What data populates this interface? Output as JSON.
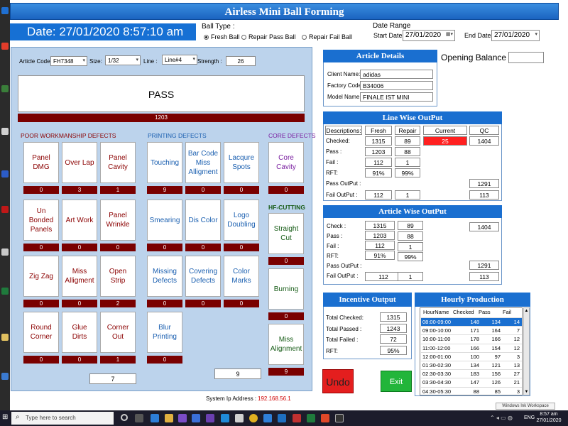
{
  "title": "Airless Mini Ball Forming",
  "datetime": "Date: 27/01/2020 8:57:10 am",
  "ball_type": {
    "label": "Ball Type :",
    "options": [
      "Fresh Ball",
      "Repair Pass Ball",
      "Repair Fail Ball"
    ],
    "selected": "Fresh Ball"
  },
  "date_range": {
    "label": "Date Range",
    "start_label": "Start Date:",
    "start_value": "27/01/2020",
    "end_label": "End Date:",
    "end_value": "27/01/2020"
  },
  "filters": {
    "article_code_label": "Article Code:",
    "article_code": "FH7348",
    "size_label": "Size:",
    "size": "1/32",
    "line_label": "Line :",
    "line": "Line#4",
    "strength_label": "Strength :",
    "strength": "26"
  },
  "pass": {
    "label": "PASS",
    "count": "1203"
  },
  "sections": {
    "poor": "POOR WORKMANSHIP DEFECTS",
    "printing": "PRINTING DEFECTS",
    "core": "CORE DEFECTS",
    "hf": "HF-CUTTING"
  },
  "defects": {
    "panel_dmg": {
      "label": "Panel DMG",
      "count": "0"
    },
    "over_lap": {
      "label": "Over Lap",
      "count": "3"
    },
    "panel_cavity": {
      "label": "Panel Cavity",
      "count": "1"
    },
    "un_bonded": {
      "label": "Un Bonded Panels",
      "count": "0"
    },
    "art_work": {
      "label": "Art Work",
      "count": "0"
    },
    "panel_wrinkle": {
      "label": "Panel Wrinkle",
      "count": "0"
    },
    "zig_zag": {
      "label": "Zig Zag",
      "count": "0"
    },
    "miss_alligment": {
      "label": "Miss Alligment",
      "count": "0"
    },
    "open_strip": {
      "label": "Open Strip",
      "count": "2"
    },
    "round_corner": {
      "label": "Round Corner",
      "count": "0"
    },
    "glue_dirts": {
      "label": "Glue Dirts",
      "count": "0"
    },
    "corner_out": {
      "label": "Corner Out",
      "count": "1"
    },
    "touching": {
      "label": "Touching",
      "count": "9"
    },
    "bar_code": {
      "label": "Bar Code Miss Alligment",
      "count": "0"
    },
    "lacqure": {
      "label": "Lacqure Spots",
      "count": "0"
    },
    "smearing": {
      "label": "Smearing",
      "count": "0"
    },
    "dis_color": {
      "label": "Dis Color",
      "count": "0"
    },
    "logo_doubling": {
      "label": "Logo Doubling",
      "count": "0"
    },
    "missing_defects": {
      "label": "Missing Defects",
      "count": "0"
    },
    "covering_defects": {
      "label": "Covering Defects",
      "count": "0"
    },
    "color_marks": {
      "label": "Color Marks",
      "count": "0"
    },
    "blur_printing": {
      "label": "Blur Printing",
      "count": "0"
    },
    "core_cavity": {
      "label": "Core Cavity",
      "count": "0"
    },
    "straight_cut": {
      "label": "Straight Cut",
      "count": "0"
    },
    "burning": {
      "label": "Burning",
      "count": "0"
    },
    "miss_alignment": {
      "label": "Miss Alignment",
      "count": "9"
    }
  },
  "totals": {
    "poor": "7",
    "printing": "9"
  },
  "ip": {
    "label": "System Ip Address :",
    "value": "192.168.56.1"
  },
  "opening_balance": {
    "label": "Opening Balance :",
    "value": ""
  },
  "article_details": {
    "title": "Article Details",
    "client_label": "Client Name:",
    "client": "adidas",
    "factory_label": "Factory Code:",
    "factory": "B34006",
    "model_label": "Model Name:",
    "model": "FINALE IST MINI"
  },
  "line_wise": {
    "title": "Line Wise OutPut",
    "headers": [
      "Descriptions:",
      "Fresh",
      "Repair",
      "Current Balance",
      "QC OutPut"
    ],
    "checked_label": "Checked:",
    "checked_fresh": "1315",
    "checked_repair": "89",
    "current_balance": "25",
    "qc_output": "1404",
    "pass_label": "Pass :",
    "pass_fresh": "1203",
    "pass_repair": "88",
    "fail_label": "Fail :",
    "fail_fresh": "112",
    "fail_repair": "1",
    "rft_label": "RFT:",
    "rft_fresh": "91%",
    "rft_repair": "99%",
    "pass_output_label": "Pass OutPut :",
    "pass_output": "1291",
    "fail_output_label": "Fail OutPut :",
    "fail_output_fresh": "112",
    "fail_output_repair": "1",
    "fail_output_total": "113"
  },
  "article_wise": {
    "title": "Article Wise OutPut",
    "check_label": "Check :",
    "check_fresh": "1315",
    "check_repair": "89",
    "check_total": "1404",
    "pass_label": "Pass :",
    "pass_fresh": "1203",
    "pass_repair": "88",
    "fail_label": "Fail :",
    "fail_fresh": "112",
    "fail_repair": "1",
    "rft_label": "RFT:",
    "rft_fresh": "91%",
    "rft_repair": "99%",
    "pass_output_label": "Pass OutPut :",
    "pass_output": "1291",
    "fail_output_label": "Fail OutPut :",
    "fail_output_fresh": "112",
    "fail_output_repair": "1",
    "fail_output_total": "113"
  },
  "incentive": {
    "title": "Incentive Output",
    "checked_label": "Total Checked:",
    "checked": "1315",
    "passed_label": "Total Passed :",
    "passed": "1243",
    "failed_label": "Total Failed :",
    "failed": "72",
    "rft_label": "RFT:",
    "rft": "95%"
  },
  "hourly": {
    "title": "Hourly Production",
    "headers": [
      "HourName",
      "Checked",
      "Pass",
      "Fail"
    ],
    "rows": [
      [
        "08:00-09:00",
        "148",
        "134",
        "14"
      ],
      [
        "09:00-10:00",
        "171",
        "164",
        "7"
      ],
      [
        "10:00-11:00",
        "178",
        "166",
        "12"
      ],
      [
        "11:00-12:00",
        "166",
        "154",
        "12"
      ],
      [
        "12:00-01:00",
        "100",
        "97",
        "3"
      ],
      [
        "01:30-02:30",
        "134",
        "121",
        "13"
      ],
      [
        "02:30-03:30",
        "183",
        "156",
        "27"
      ],
      [
        "03:30-04:30",
        "147",
        "126",
        "21"
      ],
      [
        "04:30-05:30",
        "88",
        "85",
        "3"
      ]
    ]
  },
  "buttons": {
    "undo": "Undo",
    "exit": "Exit"
  },
  "taskbar": {
    "search": "Type here to search",
    "lang": "ENG",
    "time": "8:57 am",
    "date": "27/01/2020",
    "watermark": "Windows Ink Workspace"
  },
  "colors": {
    "title_blue": "#1b63c0",
    "count_red": "#7a0000",
    "undo_red": "#e41e1e",
    "exit_green": "#22b53a",
    "balance_red": "#ff2020"
  }
}
